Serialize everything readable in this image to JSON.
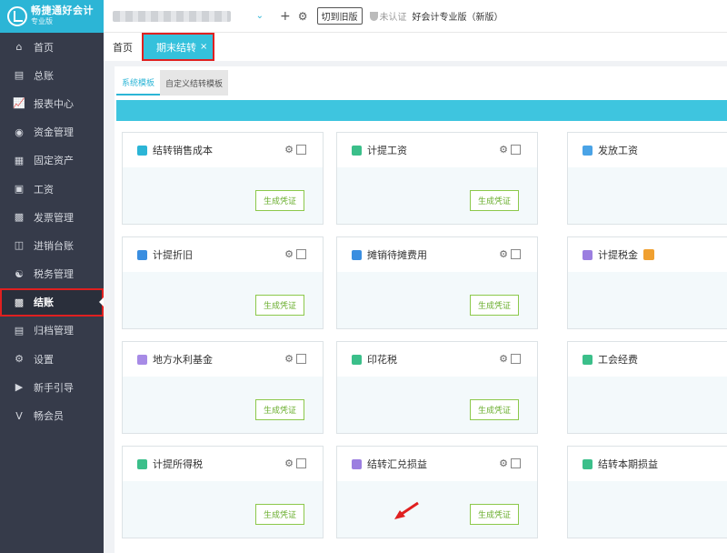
{
  "app": {
    "title": "畅捷通好会计",
    "subtitle": "专业版"
  },
  "nav": [
    {
      "label": "首页",
      "icon": "home-icon"
    },
    {
      "label": "总账",
      "icon": "ledger-icon"
    },
    {
      "label": "报表中心",
      "icon": "chart-icon"
    },
    {
      "label": "资金管理",
      "icon": "money-icon"
    },
    {
      "label": "固定资产",
      "icon": "building-icon"
    },
    {
      "label": "工资",
      "icon": "salary-icon"
    },
    {
      "label": "发票管理",
      "icon": "invoice-icon"
    },
    {
      "label": "进销台账",
      "icon": "inventory-icon"
    },
    {
      "label": "税务管理",
      "icon": "tax-icon"
    },
    {
      "label": "结账",
      "icon": "closing-icon",
      "active": true
    },
    {
      "label": "归档管理",
      "icon": "archive-icon"
    },
    {
      "label": "设置",
      "icon": "gear-icon"
    },
    {
      "label": "新手引导",
      "icon": "guide-icon"
    },
    {
      "label": "畅会员",
      "icon": "vip-icon"
    }
  ],
  "topbar": {
    "switch_old": "切到旧版",
    "auth_status": "未认证",
    "edition": "好会计专业版（新版）"
  },
  "tabs": {
    "home": "首页",
    "current": "期末结转",
    "close": "×"
  },
  "subtabs": {
    "system": "系统模板",
    "custom": "自定义结转模板"
  },
  "cards": [
    {
      "title": "结转销售成本",
      "color": "#2cb5d6",
      "gen": "生成凭证"
    },
    {
      "title": "计提工资",
      "color": "#3bbf8a",
      "gen": "生成凭证"
    },
    {
      "title": "发放工资",
      "color": "#4aa3e6",
      "gen": ""
    },
    {
      "title": "计提折旧",
      "color": "#3a8ee0",
      "gen": "生成凭证"
    },
    {
      "title": "摊销待摊费用",
      "color": "#3a8ee0",
      "gen": "生成凭证"
    },
    {
      "title": "计提税金",
      "color": "#9b7ee0",
      "gen": ""
    },
    {
      "title": "地方水利基金",
      "color": "#a78be6",
      "gen": "生成凭证"
    },
    {
      "title": "印花税",
      "color": "#3bbf8a",
      "gen": "生成凭证"
    },
    {
      "title": "工会经费",
      "color": "#3bbf8a",
      "gen": ""
    },
    {
      "title": "计提所得税",
      "color": "#3bbf8a",
      "gen": "生成凭证"
    },
    {
      "title": "结转汇兑损益",
      "color": "#9b7ee0",
      "gen": "生成凭证"
    },
    {
      "title": "结转本期损益",
      "color": "#3bbf8a",
      "gen": ""
    }
  ]
}
